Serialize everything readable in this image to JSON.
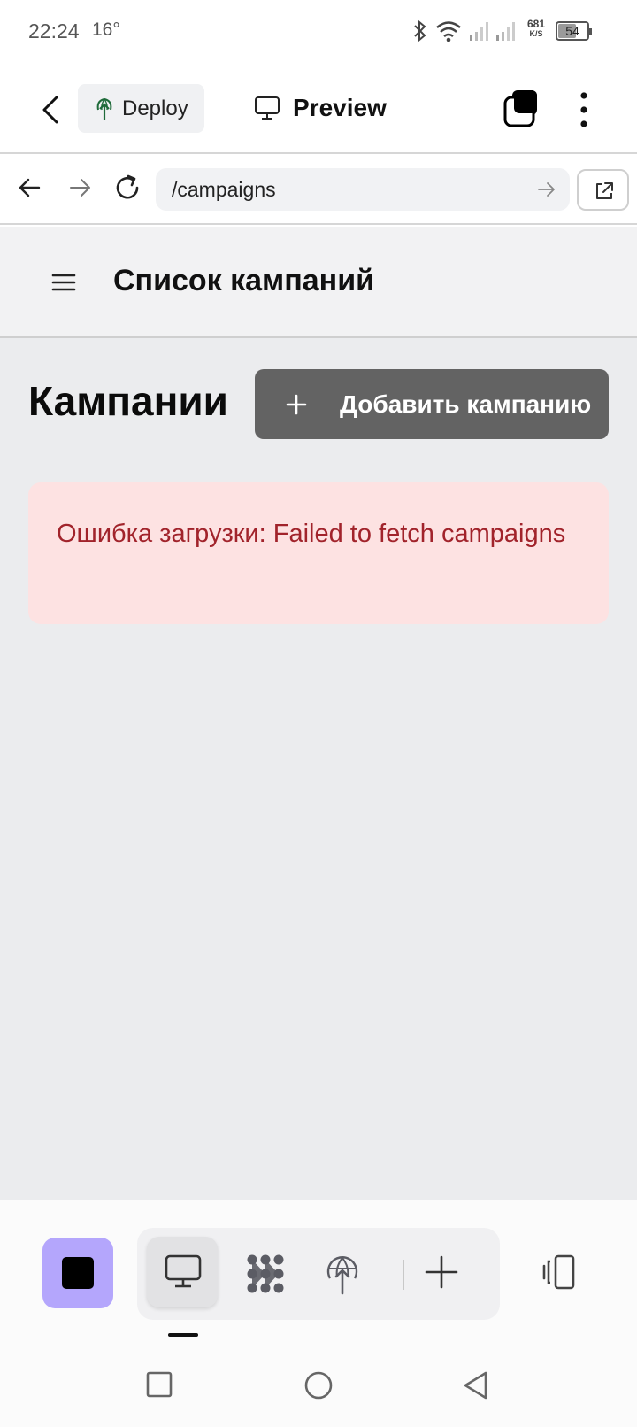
{
  "status_bar": {
    "time": "22:24",
    "temperature": "16°",
    "net_speed_value": "681",
    "net_speed_unit": "K/S",
    "battery": "54"
  },
  "app_bar": {
    "deploy_label": "Deploy",
    "preview_label": "Preview",
    "icons": [
      "back-arrow-icon",
      "deploy-tree-icon",
      "monitor-icon",
      "tabs-icon",
      "more-vertical-icon"
    ]
  },
  "browser": {
    "url": "/campaigns",
    "icons": [
      "nav-back-icon",
      "nav-forward-icon",
      "reload-icon",
      "go-arrow-icon",
      "open-external-icon"
    ]
  },
  "page": {
    "header_title": "Список кампаний",
    "heading": "Кампании",
    "add_button_label": "Добавить кампанию",
    "error_message": "Ошибка загрузки: Failed to fetch campaigns"
  },
  "colors": {
    "accent_purple": "#b4a6fc",
    "error_bg": "#fde2e2",
    "error_text": "#a1232b",
    "button_gray": "#636363"
  },
  "bottom_bar": {
    "tools": [
      "preview-tool",
      "graph-tool",
      "deploy-tool",
      "add-tool"
    ],
    "active_tool": "preview-tool"
  }
}
